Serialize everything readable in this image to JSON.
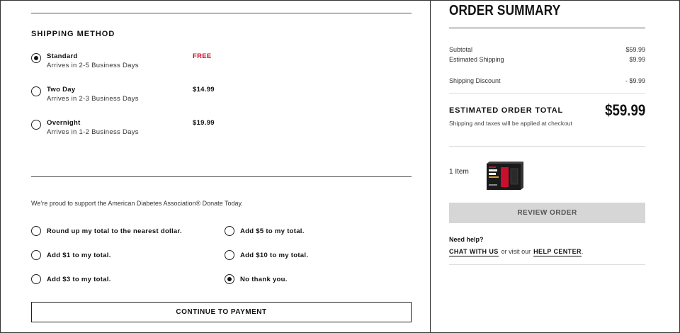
{
  "shipping": {
    "title": "SHIPPING METHOD",
    "options": [
      {
        "name": "Standard",
        "sub": "Arrives in 2-5 Business Days",
        "price": "FREE",
        "selected": true
      },
      {
        "name": "Two Day",
        "sub": "Arrives in 2-3 Business Days",
        "price": "$14.99",
        "selected": false
      },
      {
        "name": "Overnight",
        "sub": "Arrives in 1-2 Business Days",
        "price": "$19.99",
        "selected": false
      }
    ],
    "free_color": "#c8102e"
  },
  "donation": {
    "text": "We’re proud to support the American Diabetes Association® Donate Today.",
    "options": [
      {
        "label": "Round up my total to the nearest dollar.",
        "selected": false
      },
      {
        "label": "Add $1 to my total.",
        "selected": false
      },
      {
        "label": "Add $3 to my total.",
        "selected": false
      },
      {
        "label": "Add $5 to my total.",
        "selected": false
      },
      {
        "label": "Add $10 to my total.",
        "selected": false
      },
      {
        "label": "No thank you.",
        "selected": true
      }
    ]
  },
  "continue_label": "CONTINUE TO PAYMENT",
  "summary": {
    "title": "ORDER SUMMARY",
    "subtotal_label": "Subtotal",
    "subtotal_value": "$59.99",
    "shipping_label": "Estimated Shipping",
    "shipping_value": "$9.99",
    "discount_label": "Shipping Discount",
    "discount_value": "- $9.99",
    "total_label": "ESTIMATED ORDER TOTAL",
    "total_value": "$59.99",
    "total_note": "Shipping and taxes will be applied at checkout",
    "items_label": "1 Item",
    "product_image_icon": "product-box-image",
    "review_label": "REVIEW ORDER"
  },
  "help": {
    "title": "Need help?",
    "chat_label": "CHAT WITH US",
    "mid_text": "or visit our",
    "center_label": "HELP CENTER",
    "trail": "."
  }
}
